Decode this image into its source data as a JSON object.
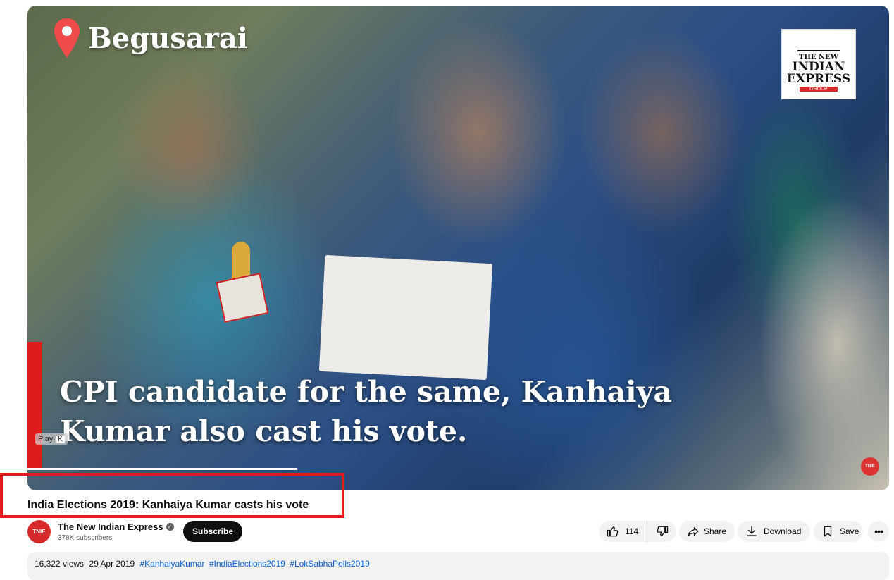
{
  "video": {
    "location": "Begusarai",
    "caption_line1": "CPI candidate for the same, Kanhaiya",
    "caption_line2": "Kumar also cast his vote.",
    "brand_l1": "THE NEW",
    "brand_l2": "INDIAN",
    "brand_l3": "EXPRESS",
    "brand_l4": "GROUP",
    "play_label": "Play",
    "play_key": "K",
    "watermark": "TNIE"
  },
  "title": "India Elections 2019: Kanhaiya Kumar casts his vote",
  "channel": {
    "avatar_text": "TNIE",
    "name": "The New Indian Express",
    "subscribers": "378K subscribers",
    "subscribe_label": "Subscribe"
  },
  "actions": {
    "like_count": "114",
    "share_label": "Share",
    "download_label": "Download",
    "save_label": "Save"
  },
  "description": {
    "views": "16,322 views",
    "date": "29 Apr 2019",
    "tags": [
      "#KanhaiyaKumar",
      "#IndiaElections2019",
      "#LokSabhaPolls2019"
    ]
  },
  "colors": {
    "highlight": "#e01b1b",
    "link": "#065fd4"
  }
}
